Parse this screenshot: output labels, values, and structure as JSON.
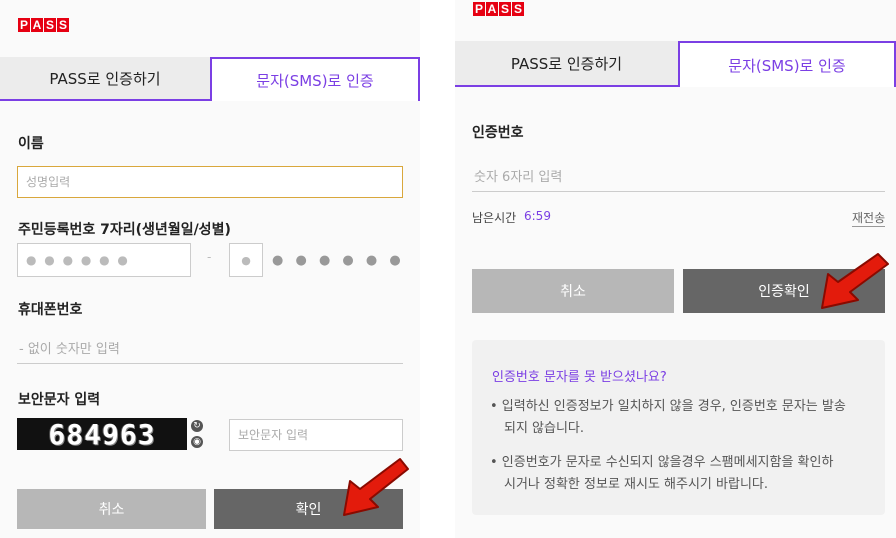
{
  "brand": {
    "logo_letters": [
      "P",
      "A",
      "S",
      "S"
    ],
    "accent": "#7b3fe4",
    "logo_color": "#e60012"
  },
  "left": {
    "tabs": [
      {
        "label": "PASS로 인증하기",
        "active": false
      },
      {
        "label": "문자(SMS)로 인증",
        "active": true
      }
    ],
    "name": {
      "label": "이름",
      "placeholder": "성명입력"
    },
    "rrn": {
      "label": "주민등록번호 7자리(생년월일/성별)",
      "dash": "-",
      "first_masked": "● ● ● ● ● ●",
      "second_masked": "●",
      "rest_masked": "● ● ● ● ● ●"
    },
    "phone": {
      "label": "휴대폰번호",
      "placeholder": "- 없이 숫자만 입력"
    },
    "security": {
      "label": "보안문자 입력",
      "captcha_text": "684963",
      "placeholder": "보안문자 입력",
      "refresh_icon": "refresh-icon",
      "audio_icon": "audio-icon"
    },
    "buttons": {
      "cancel": "취소",
      "confirm": "확인"
    }
  },
  "right": {
    "tabs": [
      {
        "label": "PASS로 인증하기",
        "active": false
      },
      {
        "label": "문자(SMS)로 인증",
        "active": true
      }
    ],
    "code": {
      "label": "인증번호",
      "placeholder": "숫자 6자리 입력"
    },
    "timer": {
      "label": "남은시간",
      "value": "6:59",
      "resend": "재전송"
    },
    "buttons": {
      "cancel": "취소",
      "confirm": "인증확인"
    },
    "help": {
      "title": "인증번호 문자를 못 받으셨나요?",
      "items": [
        {
          "line1": "• 입력하신 인증정보가 일치하지 않을 경우, 인증번호 문자는 발송",
          "line2": "되지 않습니다."
        },
        {
          "line1": "• 인증번호가 문자로 수신되지 않을경우 스팸메세지함을 확인하",
          "line2": "시거나 정확한 정보로 재시도 해주시기 바랍니다."
        }
      ]
    }
  }
}
